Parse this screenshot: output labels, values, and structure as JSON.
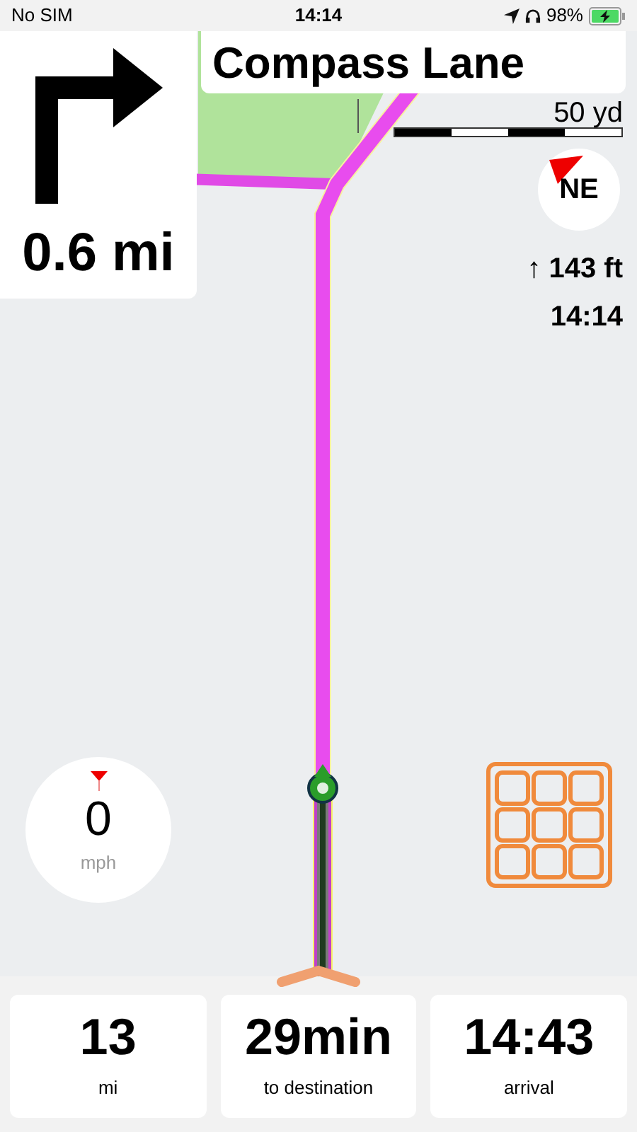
{
  "status_bar": {
    "carrier": "No SIM",
    "time": "14:14",
    "battery": "98%"
  },
  "maneuver": {
    "distance": "0.6 mi"
  },
  "street": {
    "name": "Compass Lane"
  },
  "scale": {
    "label": "50 yd"
  },
  "compass": {
    "heading": "NE"
  },
  "altitude": "↑ 143 ft",
  "clock": "14:14",
  "speedometer": {
    "value": "0",
    "unit": "mph"
  },
  "stats": [
    {
      "value": "13",
      "label": "mi"
    },
    {
      "value": "29min",
      "label": "to destination"
    },
    {
      "value": "14:43",
      "label": "arrival"
    }
  ]
}
